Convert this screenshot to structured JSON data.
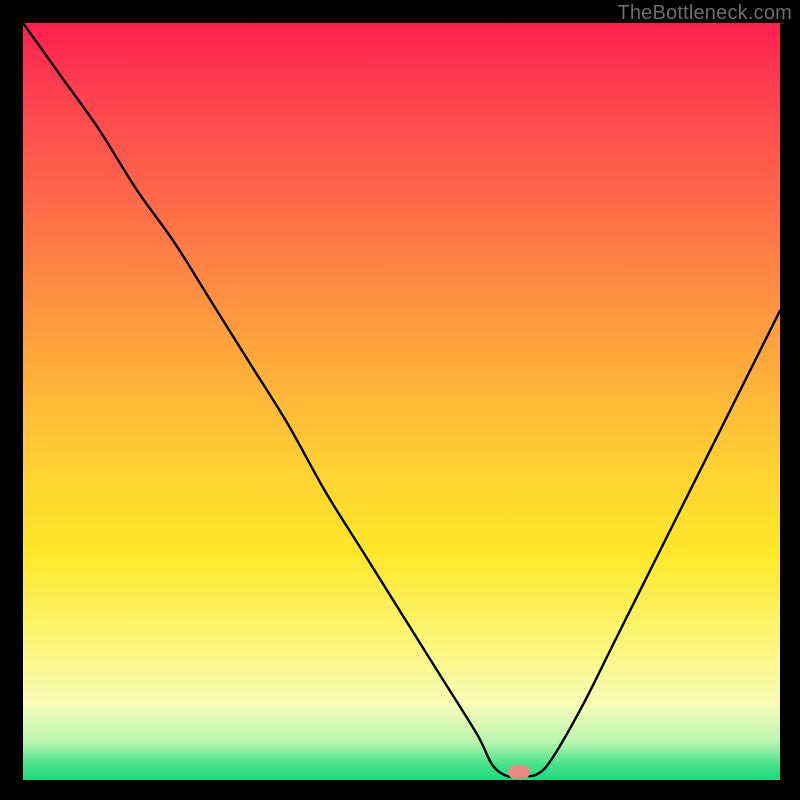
{
  "watermark": "TheBottleneck.com",
  "marker": {
    "x_pct": 65.5,
    "y_pct": 99.0
  },
  "chart_data": {
    "type": "line",
    "title": "",
    "xlabel": "",
    "ylabel": "",
    "xlim": [
      0,
      100
    ],
    "ylim": [
      0,
      100
    ],
    "grid": false,
    "series": [
      {
        "name": "bottleneck-curve",
        "x": [
          0,
          5,
          10,
          15,
          20,
          25,
          30,
          35,
          40,
          45,
          50,
          55,
          60,
          62,
          64,
          66,
          68,
          70,
          74,
          78,
          82,
          86,
          90,
          94,
          98,
          100
        ],
        "y": [
          100,
          93,
          86,
          78,
          71,
          63,
          55,
          47,
          38,
          30,
          22,
          14,
          6,
          2,
          0.5,
          0.5,
          0.8,
          3,
          10,
          18,
          26,
          34,
          42,
          50,
          58,
          62
        ]
      }
    ],
    "annotations": [
      {
        "type": "marker",
        "x": 65.5,
        "y": 1.0,
        "label": "optimal-point"
      }
    ],
    "background_gradient": {
      "top": "#ff1f4f",
      "mid": "#ffd432",
      "bottom": "#1ed97d"
    }
  }
}
